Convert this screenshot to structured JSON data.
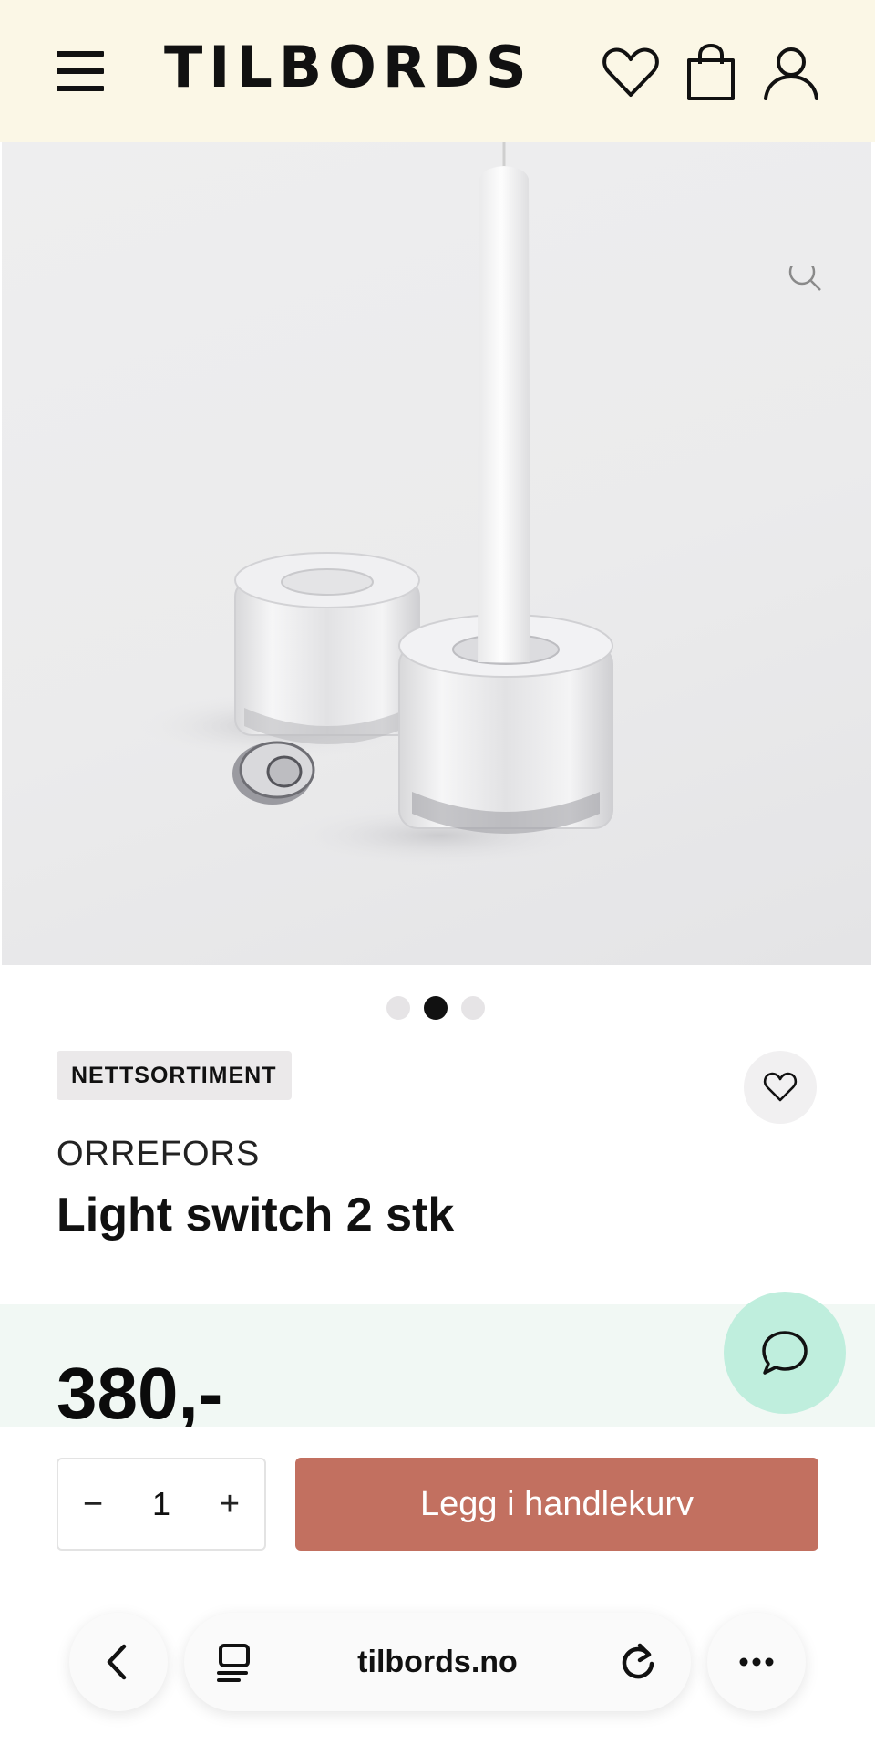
{
  "header": {
    "logo": "TILBORDS",
    "menu_icon": "hamburger-menu-icon",
    "icons": [
      "heart-icon",
      "shopping-bag-icon",
      "user-icon"
    ],
    "background": "#fbf7e6"
  },
  "gallery": {
    "image_description_icon": "zoom-icon",
    "slide_count": 3,
    "active_slide": 2
  },
  "product": {
    "badge": "NETTSORTIMENT",
    "brand": "ORREFORS",
    "title": "Light switch 2 stk",
    "price": "380,-",
    "favorite_icon": "heart-icon"
  },
  "purchase": {
    "quantity": "1",
    "minus_label": "−",
    "plus_label": "+",
    "add_to_cart_label": "Legg i handlekurv",
    "button_color": "#c27060"
  },
  "chat": {
    "icon": "chat-bubble-icon",
    "color": "#bfeedd"
  },
  "browser": {
    "url": "tilbords.no",
    "icons": [
      "back-arrow-icon",
      "tabs-icon",
      "reload-icon",
      "more-icon"
    ]
  }
}
